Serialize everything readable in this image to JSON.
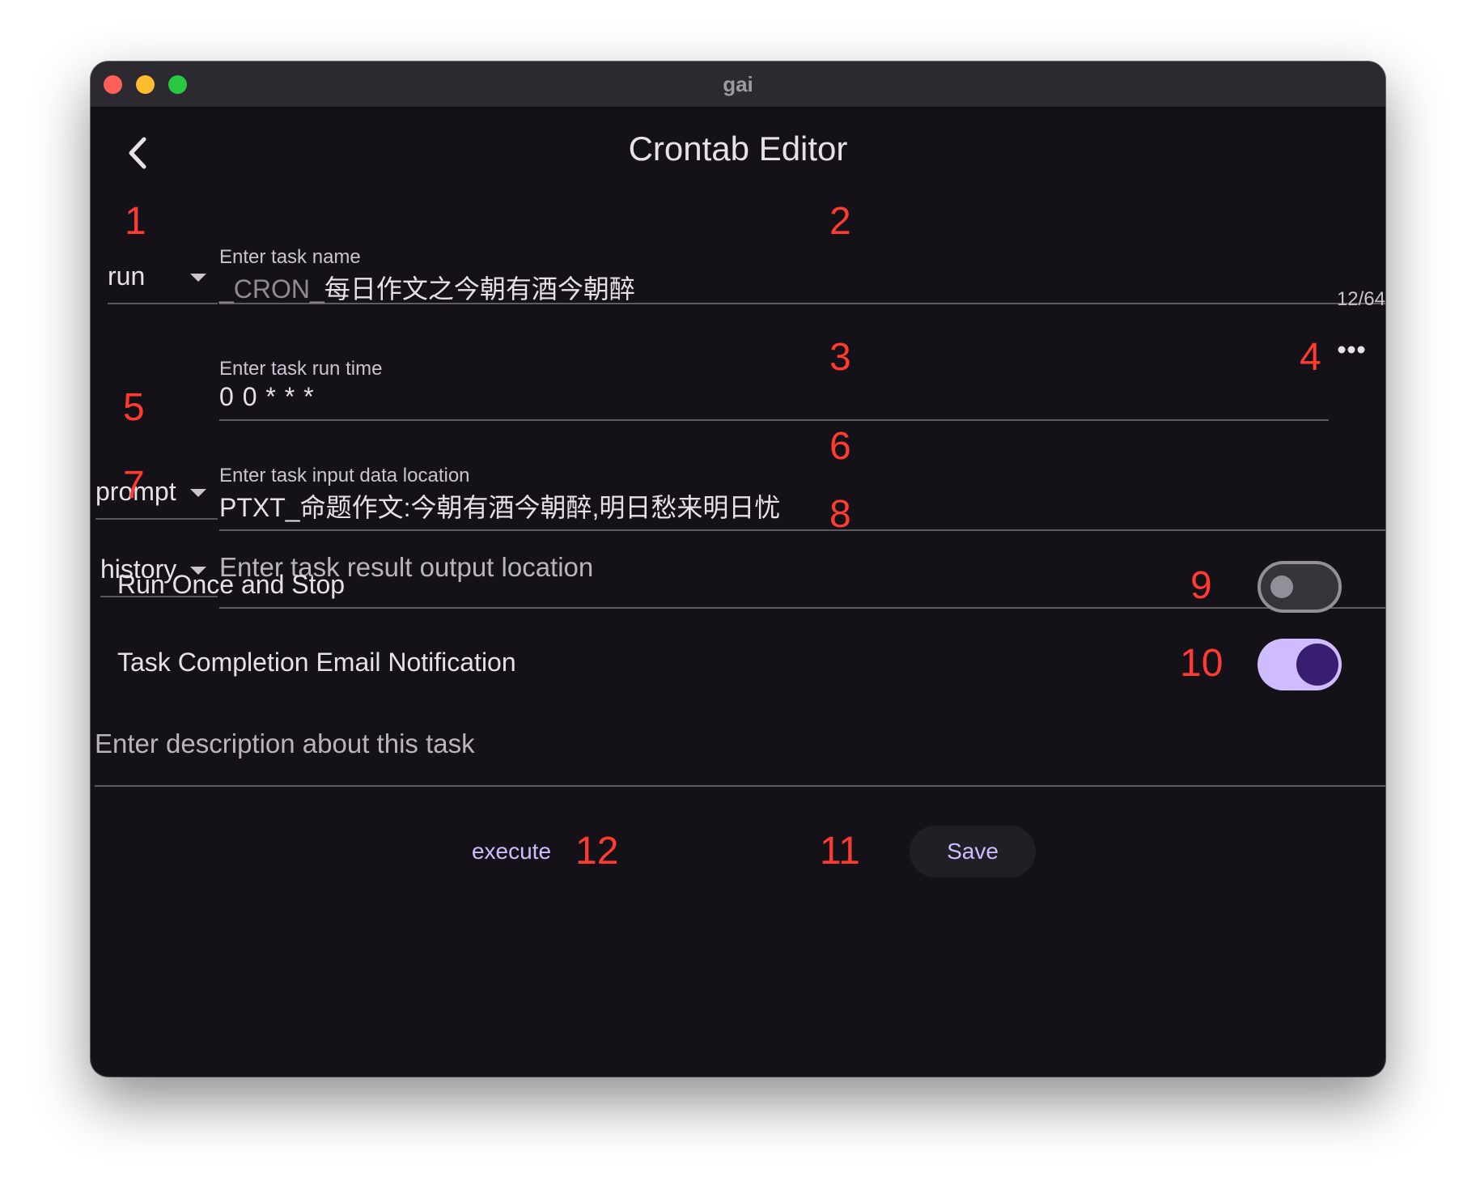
{
  "window": {
    "title": "gai"
  },
  "header": {
    "title": "Crontab Editor"
  },
  "task_name": {
    "type_value": "run",
    "label": "Enter task name",
    "prefix": "_CRON_",
    "value": "每日作文之今朝有酒今朝醉",
    "counter": "12/64"
  },
  "run_time": {
    "label": "Enter task run time",
    "value": "0 0 * * *"
  },
  "input": {
    "type_value": "prompt",
    "label": "Enter task input data location",
    "value": "PTXT_命题作文:今朝有酒今朝醉,明日愁来明日忧"
  },
  "output": {
    "type_value": "history",
    "placeholder": "Enter task result output location"
  },
  "toggles": {
    "run_once": {
      "label": "Run Once and Stop",
      "on": false
    },
    "email": {
      "label": "Task Completion Email Notification",
      "on": true
    }
  },
  "description": {
    "placeholder": "Enter description about this task"
  },
  "actions": {
    "execute": "execute",
    "save": "Save"
  },
  "markers": [
    "1",
    "2",
    "3",
    "4",
    "5",
    "6",
    "7",
    "8",
    "9",
    "10",
    "11",
    "12"
  ],
  "colors": {
    "accent": "#cfbcff",
    "background": "#141218",
    "marker": "#ff3b30"
  }
}
